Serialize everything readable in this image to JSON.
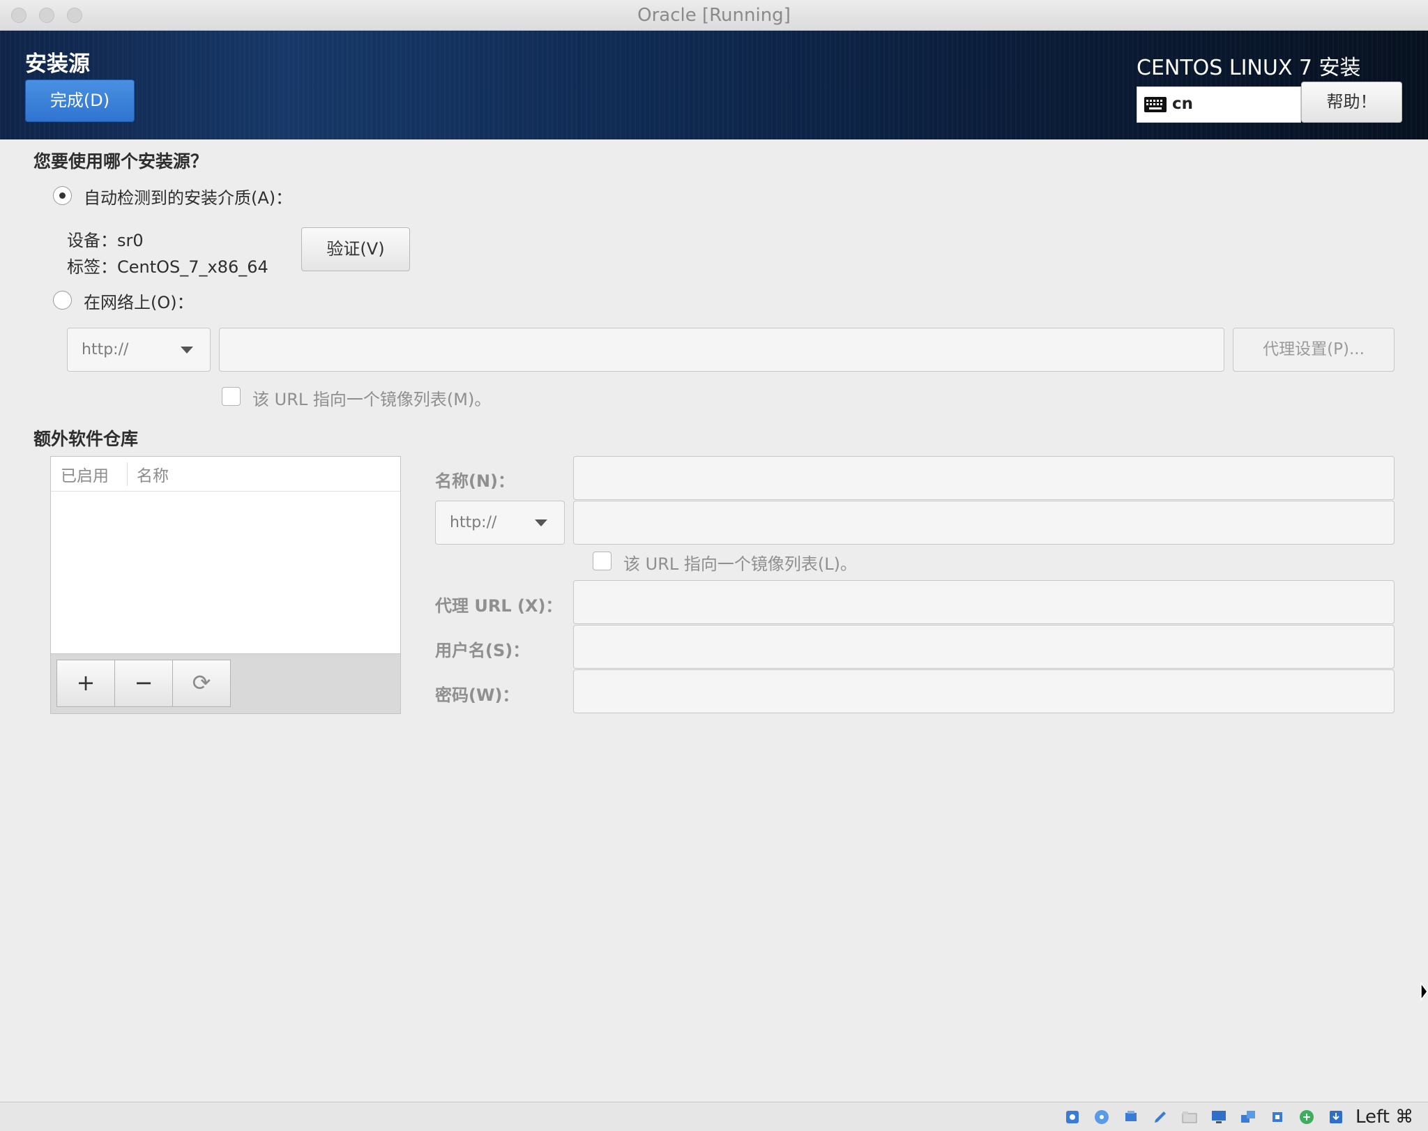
{
  "window": {
    "title": "Oracle [Running]"
  },
  "header": {
    "spoke_title": "安装源",
    "done_label": "完成(D)",
    "product_title": "CENTOS LINUX 7 安装",
    "keyboard_layout": "cn",
    "help_label": "帮助！"
  },
  "source": {
    "question": "您要使用哪个安装源？",
    "auto_detect_label": "自动检测到的安装介质(A)：",
    "auto_selected": true,
    "device_line": "设备：sr0",
    "label_line": "标签：CentOS_7_x86_64",
    "verify_label": "验证(V)",
    "network_label": "在网络上(O)：",
    "protocol": "http://",
    "url_value": "",
    "proxy_label": "代理设置(P)...",
    "mirror_label": "该 URL 指向一个镜像列表(M)。"
  },
  "repos": {
    "heading": "额外软件仓库",
    "col_enabled": "已启用",
    "col_name": "名称",
    "add_label": "+",
    "remove_label": "−",
    "refresh_label": "⟳",
    "form": {
      "name_label": "名称(N)：",
      "protocol": "http://",
      "mirror_label": "该 URL 指向一个镜像列表(L)。",
      "proxy_url_label": "代理 URL (X)：",
      "username_label": "用户名(S)：",
      "password_label": "密码(W)："
    }
  },
  "statusbar": {
    "host_key": "Left ⌘",
    "icons": [
      "hdd-icon",
      "optical-disc-icon",
      "usb-icon",
      "pen-icon",
      "shared-folder-icon",
      "display-icon",
      "network-icon",
      "cpu-icon",
      "mouse-integration-icon",
      "download-icon"
    ]
  }
}
